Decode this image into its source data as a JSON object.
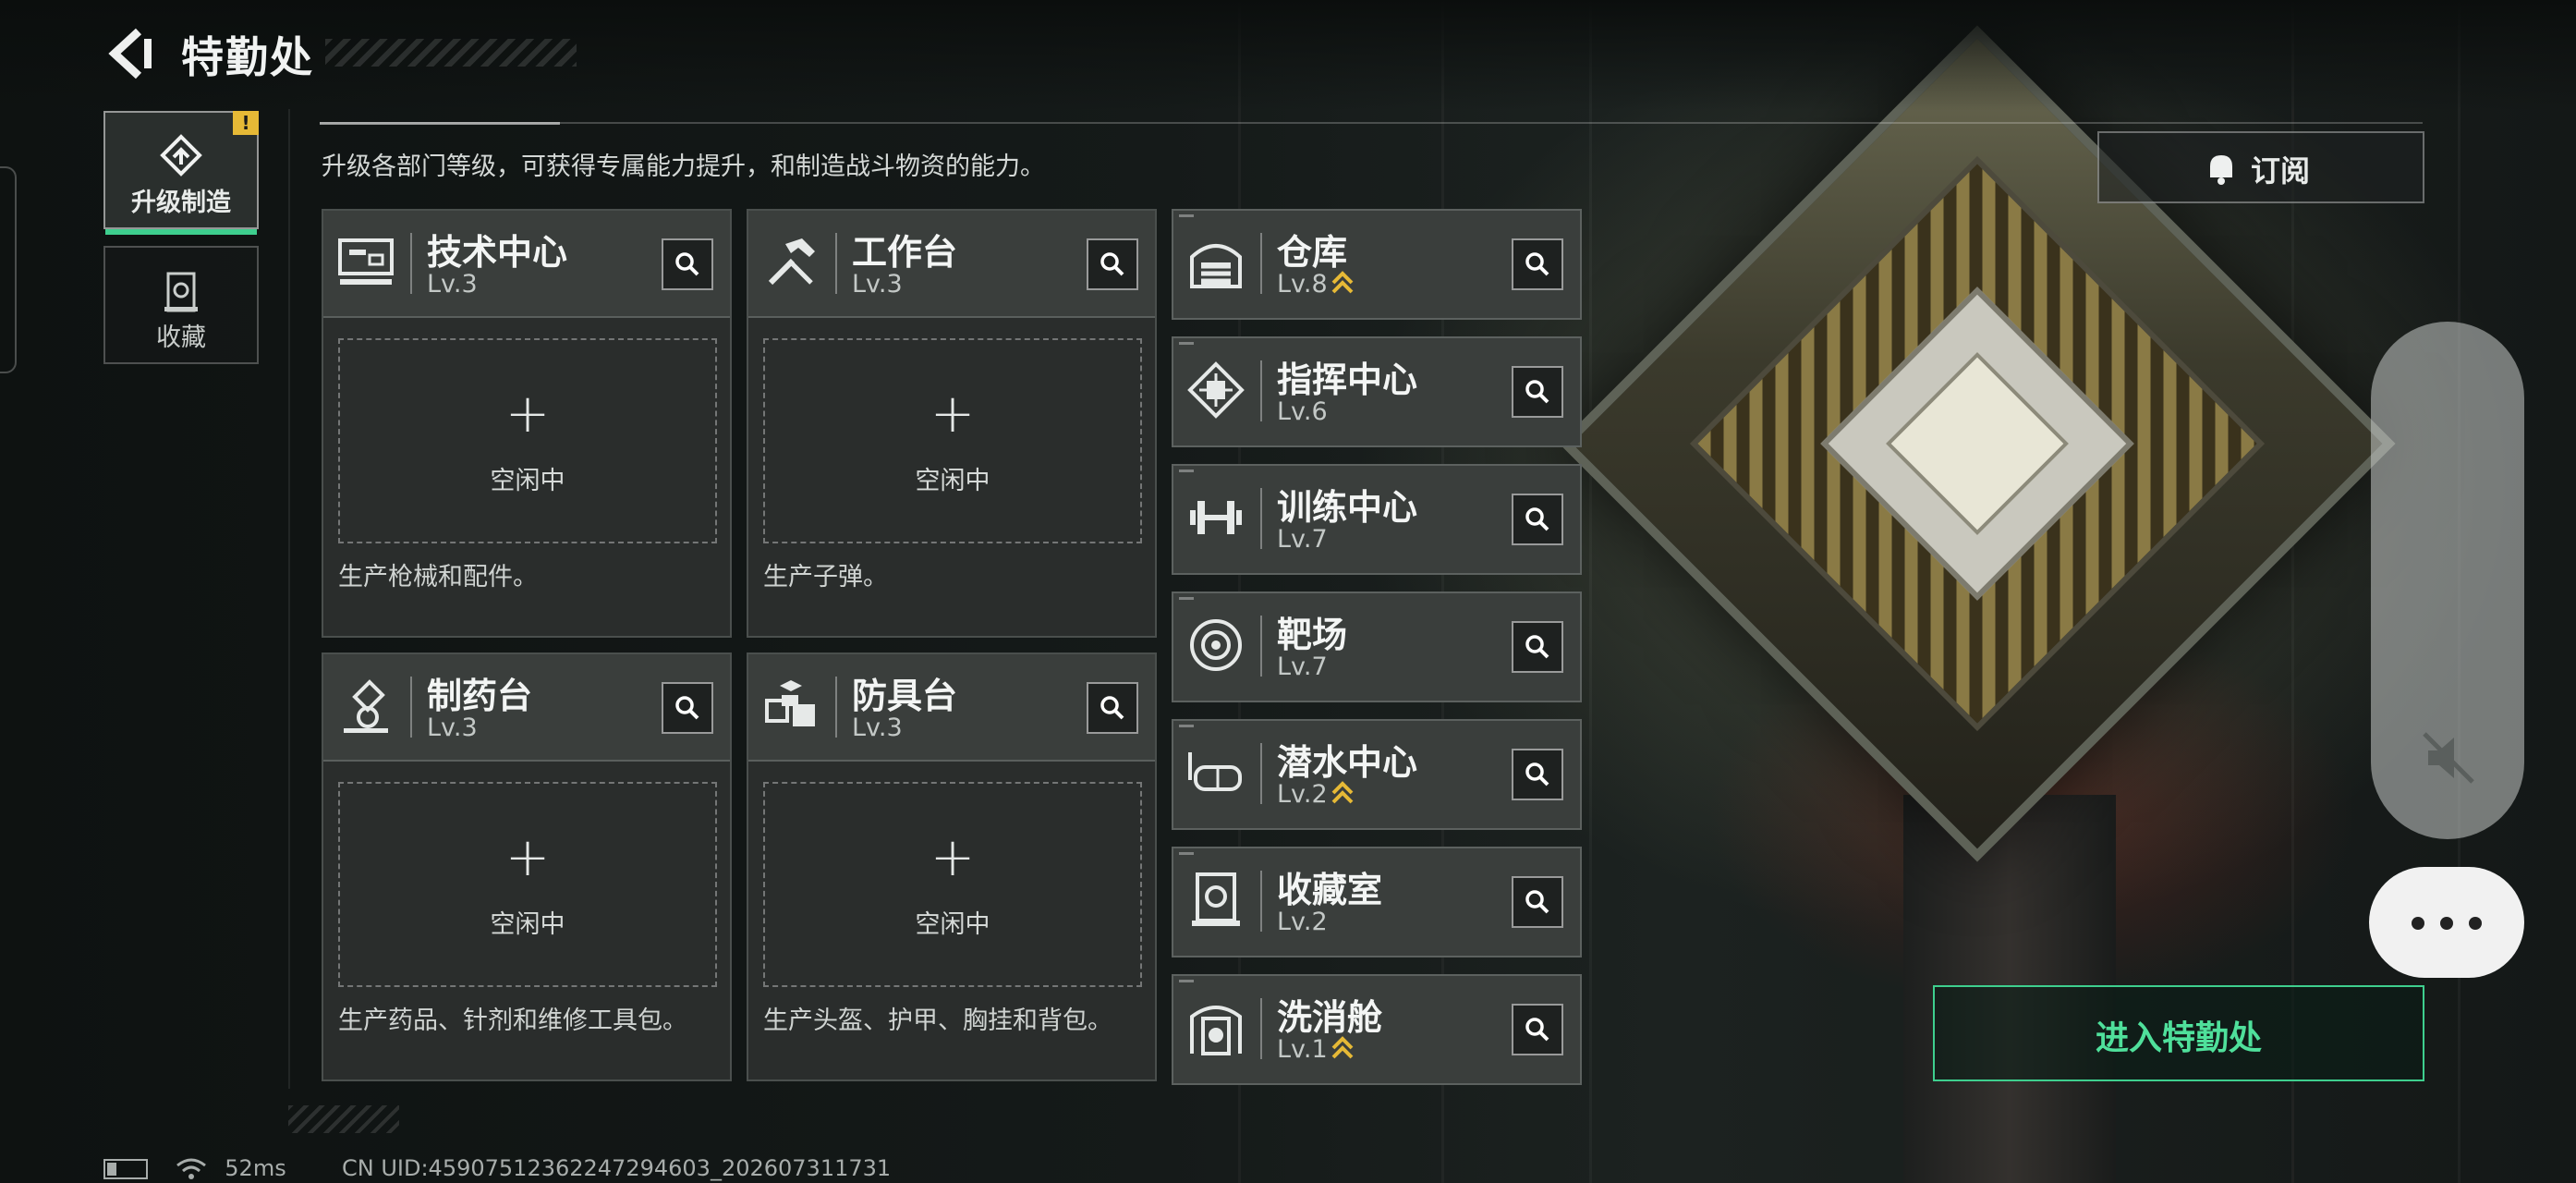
{
  "header": {
    "title": "特勤处",
    "description": "升级各部门等级，可获得专属能力提升，和制造战斗物资的能力。"
  },
  "side_tabs": [
    {
      "label": "升级制造",
      "icon": "upgrade-icon",
      "active": true,
      "alert": "!"
    },
    {
      "label": "收藏",
      "icon": "collection-icon",
      "active": false
    }
  ],
  "production": [
    {
      "name": "技术中心",
      "level": "Lv.3",
      "icon": "tech-center-icon",
      "slot_status": "空闲中",
      "slot_action": "+",
      "description": "生产枪械和配件。"
    },
    {
      "name": "工作台",
      "level": "Lv.3",
      "icon": "workbench-icon",
      "slot_status": "空闲中",
      "slot_action": "+",
      "description": "生产子弹。"
    },
    {
      "name": "制药台",
      "level": "Lv.3",
      "icon": "pharmacy-icon",
      "slot_status": "空闲中",
      "slot_action": "+",
      "description": "生产药品、针剂和维修工具包。"
    },
    {
      "name": "防具台",
      "level": "Lv.3",
      "icon": "armor-bench-icon",
      "slot_status": "空闲中",
      "slot_action": "+",
      "description": "生产头盔、护甲、胸挂和背包。"
    }
  ],
  "facilities": [
    {
      "name": "仓库",
      "level": "Lv.8",
      "upgradable": true,
      "icon": "warehouse-icon"
    },
    {
      "name": "指挥中心",
      "level": "Lv.6",
      "upgradable": false,
      "icon": "command-center-icon"
    },
    {
      "name": "训练中心",
      "level": "Lv.7",
      "upgradable": false,
      "icon": "training-center-icon"
    },
    {
      "name": "靶场",
      "level": "Lv.7",
      "upgradable": false,
      "icon": "shooting-range-icon"
    },
    {
      "name": "潜水中心",
      "level": "Lv.2",
      "upgradable": true,
      "icon": "diving-center-icon"
    },
    {
      "name": "收藏室",
      "level": "Lv.2",
      "upgradable": false,
      "icon": "collection-room-icon"
    },
    {
      "name": "洗消舱",
      "level": "Lv.1",
      "upgradable": true,
      "icon": "decontamination-icon"
    }
  ],
  "buttons": {
    "subscribe": "订阅",
    "enter": "进入特勤处"
  },
  "status": {
    "latency": "52ms",
    "uid": "CN UID:4590751236224729460­3_202607311731"
  },
  "colors": {
    "accent": "#3ecf8e",
    "upgrade_arrow": "#e6b936",
    "alert": "#e6b936"
  }
}
